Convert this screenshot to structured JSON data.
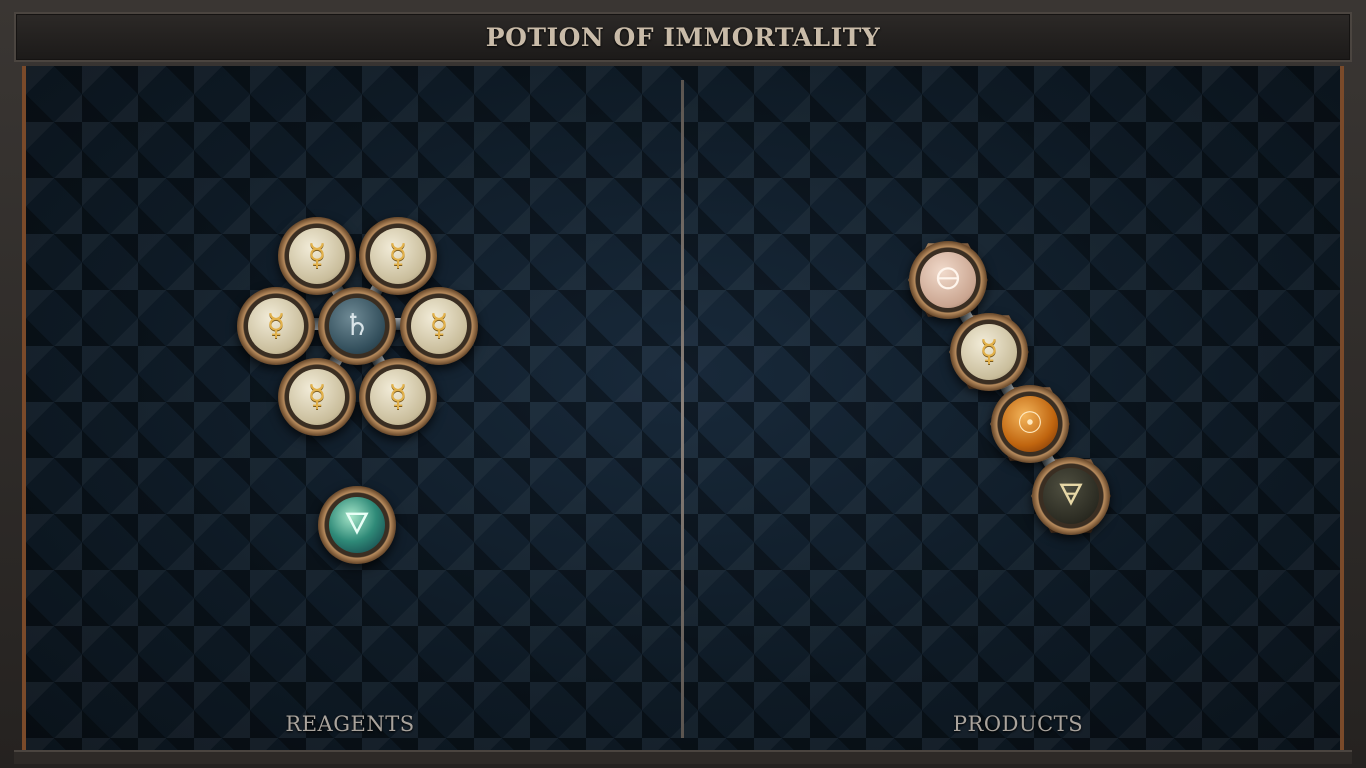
{
  "title": "POTION OF IMMORTALITY",
  "sections": {
    "reagents_label": "REAGENTS",
    "products_label": "PRODUCTS"
  },
  "reagents": {
    "molecule_1": {
      "center": {
        "element": "lead",
        "symbol": "♄"
      },
      "ring": [
        {
          "element": "mercury",
          "symbol": "☿"
        },
        {
          "element": "mercury",
          "symbol": "☿"
        },
        {
          "element": "mercury",
          "symbol": "☿"
        },
        {
          "element": "mercury",
          "symbol": "☿"
        },
        {
          "element": "mercury",
          "symbol": "☿"
        },
        {
          "element": "mercury",
          "symbol": "☿"
        }
      ]
    },
    "molecule_2": {
      "element": "water",
      "symbol": "🜄"
    }
  },
  "products": {
    "chain": [
      {
        "element": "salt",
        "symbol": "🜔"
      },
      {
        "element": "mercury",
        "symbol": "☿"
      },
      {
        "element": "gold",
        "symbol": "☉"
      },
      {
        "element": "earth",
        "symbol": "🜃"
      }
    ]
  },
  "colors": {
    "frame": "#2a2724",
    "board": "#0d1a24",
    "accent_copper": "#7a4a2a",
    "title_text": "#c9bba8"
  }
}
